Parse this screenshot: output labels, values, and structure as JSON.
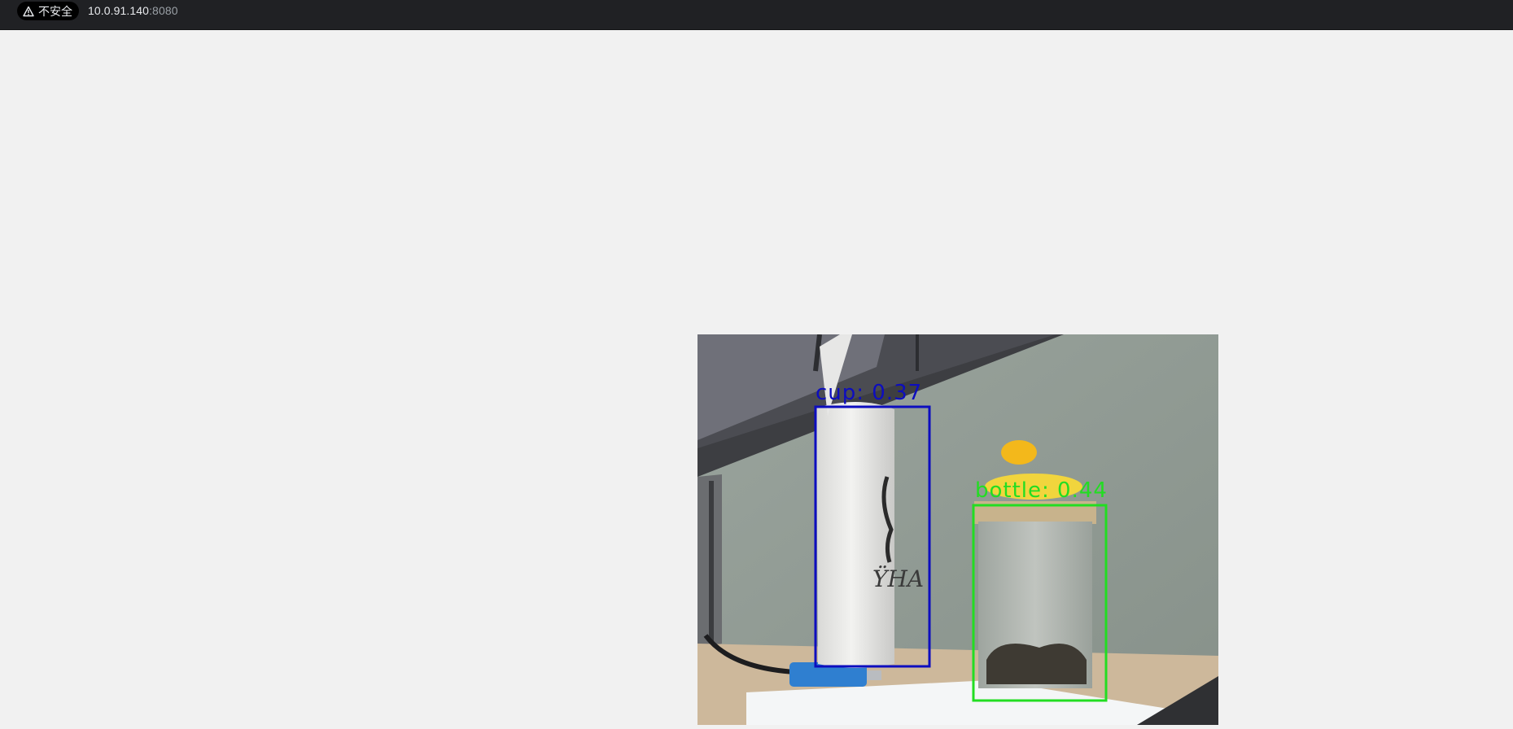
{
  "browser": {
    "security_label": "不安全",
    "security_icon": "warning-triangle-icon",
    "url_host": "10.0.91.140",
    "url_port": ":8080"
  },
  "video_feed": {
    "detections": [
      {
        "label": "cup: 0.37",
        "color": "#0d0dbf"
      },
      {
        "label": "bottle: 0.44",
        "color": "#22dd22"
      }
    ]
  }
}
